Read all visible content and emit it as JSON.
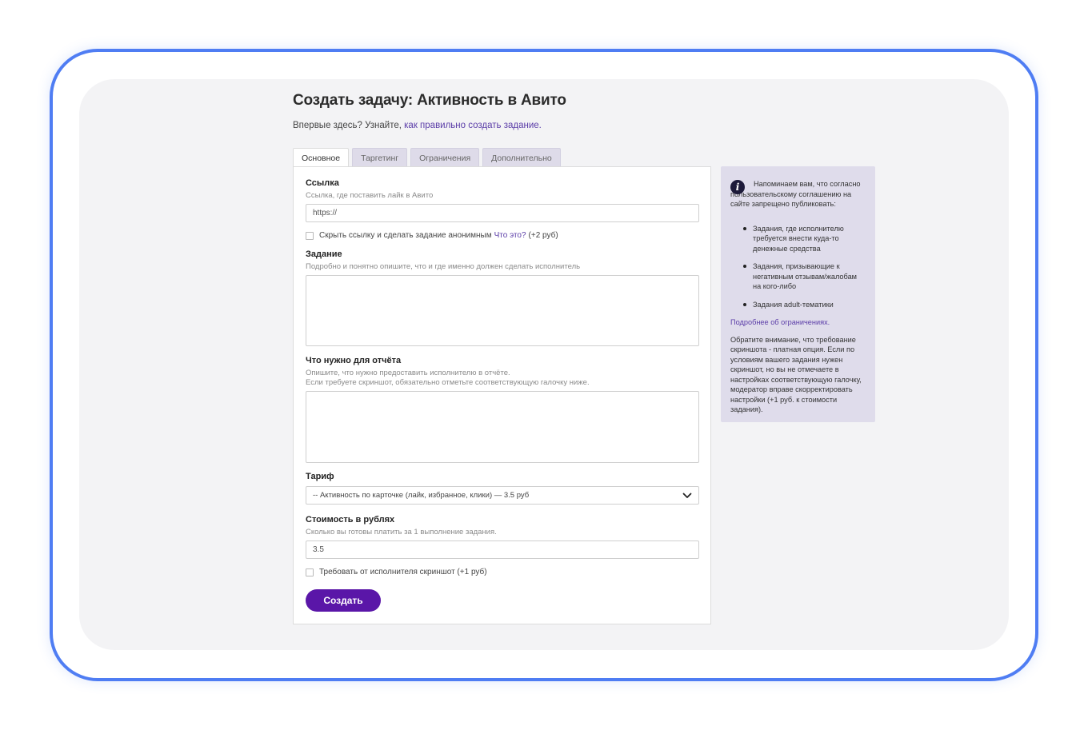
{
  "page": {
    "title": "Создать задачу: Активность в Авито",
    "intro_prefix": "Впервые здесь? Узнайте, ",
    "intro_link": "как правильно создать задание."
  },
  "tabs": [
    {
      "label": "Основное",
      "active": true
    },
    {
      "label": "Таргетинг",
      "active": false
    },
    {
      "label": "Ограничения",
      "active": false
    },
    {
      "label": "Дополнительно",
      "active": false
    }
  ],
  "form": {
    "link": {
      "label": "Ссылка",
      "hint": "Ссылка, где поставить лайк в Авито",
      "value": "https://"
    },
    "anonymous": {
      "label": "Скрыть ссылку и сделать задание анонимным",
      "link": "Что это?",
      "suffix": "(+2 руб)",
      "checked": false
    },
    "task": {
      "label": "Задание",
      "hint": "Подробно и понятно опишите, что и где именно должен сделать исполнитель",
      "value": ""
    },
    "report": {
      "label": "Что нужно для отчёта",
      "hint_line1": "Опишите, что нужно предоставить исполнителю в отчёте.",
      "hint_line2": "Если требуете скриншот, обязательно отметьте соответствующую галочку ниже.",
      "value": ""
    },
    "tariff": {
      "label": "Тариф",
      "selected": "-- Активность по карточке (лайк, избранное, клики) — 3.5 руб"
    },
    "price": {
      "label": "Стоимость в рублях",
      "hint": "Сколько вы готовы платить за 1 выполнение задания.",
      "value": "3.5"
    },
    "screenshot": {
      "label": "Требовать от исполнителя скриншот (+1 руб)",
      "checked": false
    },
    "submit_label": "Создать"
  },
  "info": {
    "intro": "Напоминаем вам, что согласно пользовательскому соглашению на сайте запрещено публиковать:",
    "items": [
      "Задания, где исполнителю требуется внести куда-то денежные средства",
      "Задания, призывающие к негативным отзывам/жалобам на кого-либо",
      "Задания adult-тематики"
    ],
    "more_link": "Подробнее об ограничениях.",
    "note": "Обратите внимание, что требование скриншота - платная опция. Если по условиям вашего задания нужен скриншот, но вы не отмечаете в настройках соответствующую галочку, модератор вправе скорректировать настройки (+1 руб. к стоимости задания)."
  },
  "colors": {
    "frame": "#4f7df3",
    "accent": "#5a16a8",
    "link": "#5b3da8",
    "info_bg": "#dfdceb"
  }
}
